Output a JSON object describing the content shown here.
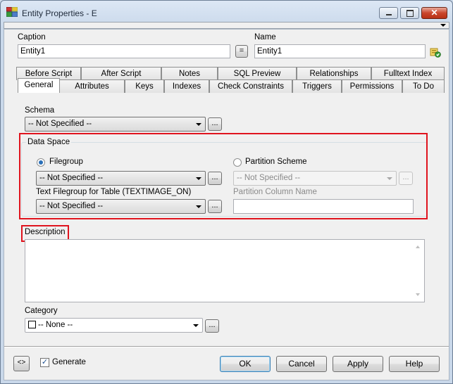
{
  "window": {
    "title": "Entity Properties - E",
    "controls": {
      "minimize": "minimize-icon",
      "maximize": "maximize-icon",
      "close": "close-icon"
    }
  },
  "header": {
    "caption_label": "Caption",
    "caption_value": "Entity1",
    "equals_button": "=",
    "name_label": "Name",
    "name_value": "Entity1"
  },
  "tabs": {
    "row1": [
      "Before Script",
      "After Script",
      "Notes",
      "SQL Preview",
      "Relationships",
      "Fulltext Index"
    ],
    "row2": [
      "General",
      "Attributes",
      "Keys",
      "Indexes",
      "Check Constraints",
      "Triggers",
      "Permissions",
      "To Do"
    ],
    "active": "General"
  },
  "general": {
    "schema_label": "Schema",
    "schema_value": "-- Not Specified --",
    "data_space": {
      "legend": "Data Space",
      "filegroup_radio": "Filegroup",
      "filegroup_value": "-- Not Specified --",
      "text_filegroup_label": "Text Filegroup for Table (TEXTIMAGE_ON)",
      "text_filegroup_value": "-- Not Specified --",
      "partition_scheme_radio": "Partition Scheme",
      "partition_scheme_value": "-- Not Specified --",
      "partition_column_label": "Partition Column Name",
      "partition_column_value": ""
    },
    "description_label": "Description",
    "description_value": "",
    "category_label": "Category",
    "category_value": "-- None --"
  },
  "ellipsis": "...",
  "footer": {
    "generate_label": "Generate",
    "generate_checked": true,
    "ok": "OK",
    "cancel": "Cancel",
    "apply": "Apply",
    "help": "Help"
  },
  "colors": {
    "highlight": "#e0141e",
    "radio_selected": "#2a6fb8",
    "close_button": "#c9462c"
  }
}
